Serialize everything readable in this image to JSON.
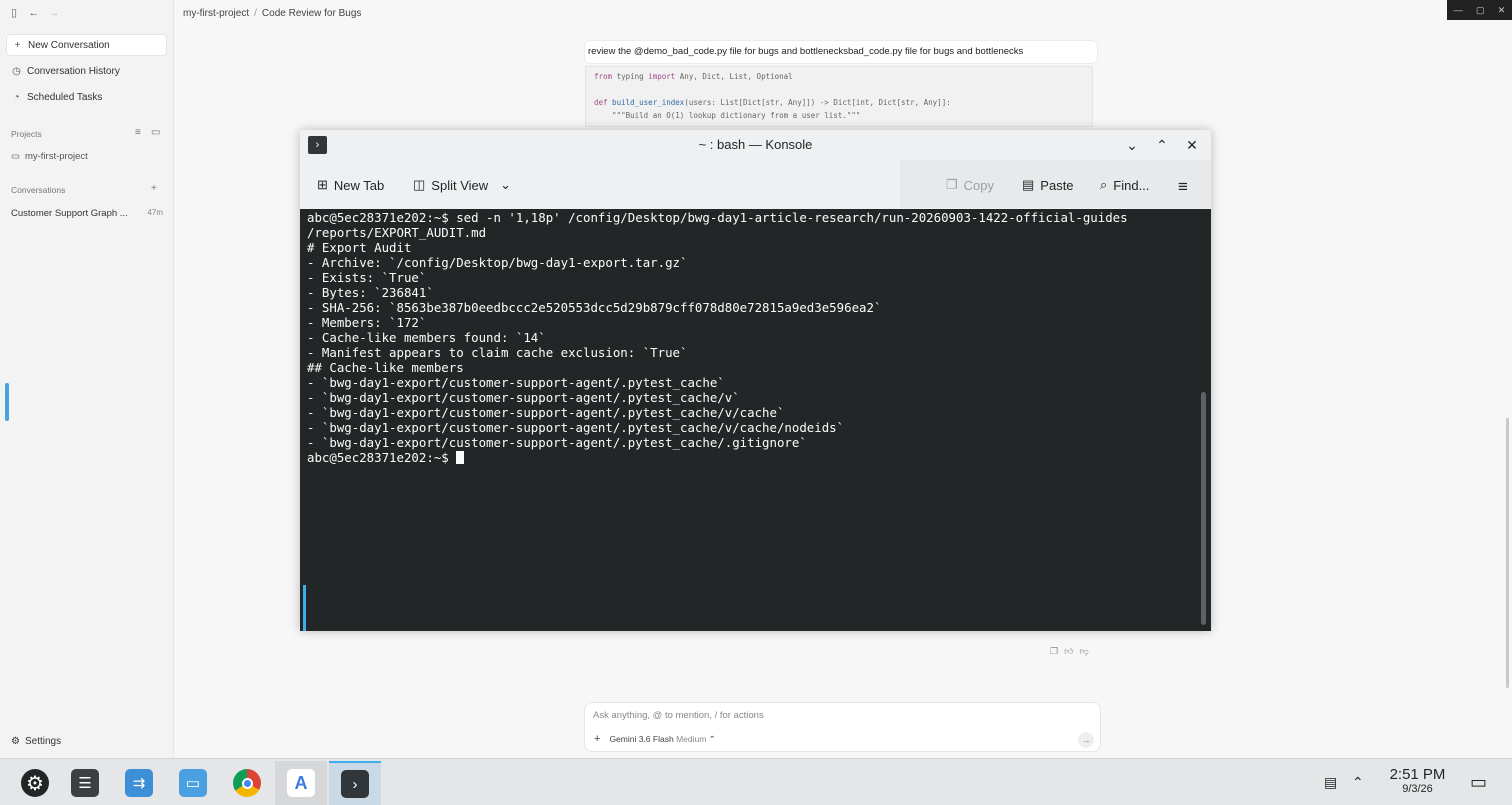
{
  "sidebar": {
    "new_conversation": "New Conversation",
    "conversation_history": "Conversation History",
    "scheduled_tasks": "Scheduled Tasks",
    "projects_label": "Projects",
    "project_name": "my-first-project",
    "conversations_label": "Conversations",
    "conversation_title": "Customer Support Graph ...",
    "conversation_time": "47m",
    "settings": "Settings"
  },
  "breadcrumb": {
    "project": "my-first-project",
    "separator": "/",
    "page": "Code Review for Bugs"
  },
  "chat": {
    "user_prompt": "review the @demo_bad_code.py file for bugs and bottlenecksbad_code.py file for bugs and bottlenecks",
    "code_line1_kw1": "from",
    "code_line1_rest": " typing ",
    "code_line1_kw2": "import",
    "code_line1_names": " Any, Dict, List, Optional",
    "code_line3_kw": "def",
    "code_line3_fn": " build_user_index",
    "code_line3_rest": "(users: List[Dict[str, Any]]) -> Dict[int, Dict[str, Any]]:",
    "code_line4": "    \"\"\"Build an O(1) lookup dictionary from a user list.\"\"\"",
    "input_placeholder": "Ask anything, @ to mention, / for actions",
    "model_name": "Gemini 3.6 Flash",
    "model_mode": "Medium"
  },
  "konsole": {
    "title": "~ : bash — Konsole",
    "new_tab": "New Tab",
    "split_view": "Split View",
    "copy": "Copy",
    "paste": "Paste",
    "find": "Find...",
    "terminal_lines": [
      "abc@5ec28371e202:~$ sed -n '1,18p' /config/Desktop/bwg-day1-article-research/run-20260903-1422-official-guides",
      "/reports/EXPORT_AUDIT.md",
      "",
      "# Export Audit",
      "",
      "- Archive: `/config/Desktop/bwg-day1-export.tar.gz`",
      "- Exists: `True`",
      "- Bytes: `236841`",
      "- SHA-256: `8563be387b0eedbccc2e520553dcc5d29b879cff078d80e72815a9ed3e596ea2`",
      "- Members: `172`",
      "- Cache-like members found: `14`",
      "- Manifest appears to claim cache exclusion: `True`",
      "",
      "## Cache-like members",
      "",
      "- `bwg-day1-export/customer-support-agent/.pytest_cache`",
      "- `bwg-day1-export/customer-support-agent/.pytest_cache/v`",
      "- `bwg-day1-export/customer-support-agent/.pytest_cache/v/cache`",
      "- `bwg-day1-export/customer-support-agent/.pytest_cache/v/cache/nodeids`",
      "- `bwg-day1-export/customer-support-agent/.pytest_cache/.gitignore`"
    ],
    "prompt": "abc@5ec28371e202:~$ "
  },
  "taskbar": {
    "time": "2:51 PM",
    "date": "9/3/26",
    "apps": [
      "system-settings-icon",
      "mixer-icon",
      "discover-store-icon",
      "file-manager-icon",
      "chrome-icon",
      "antigravity-icon",
      "konsole-icon"
    ]
  },
  "colors": {
    "terminal_bg": "#232627",
    "terminal_fg": "#fcfcfc",
    "accent": "#3daee9"
  }
}
